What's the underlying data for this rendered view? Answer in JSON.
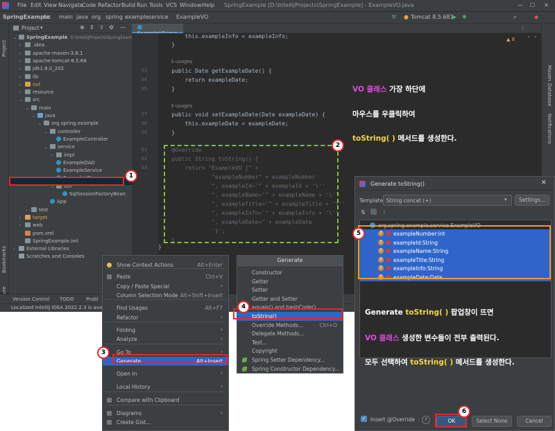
{
  "menubar": {
    "items": [
      "File",
      "Edit",
      "View",
      "Navigate",
      "Code",
      "Refactor",
      "Build",
      "Run",
      "Tools",
      "VCS",
      "Window",
      "Help"
    ],
    "title": "SpringExample [D:\\IntelliJProjects\\SpringExample] - ExampleVO.java"
  },
  "navbar": {
    "crumbs": [
      "SpringExample",
      "src",
      "main",
      "java",
      "org",
      "spring",
      "example",
      "service",
      "ExampleVO"
    ],
    "run_config": "Tomcat 8.5.681"
  },
  "project_panel": {
    "header": "Project",
    "tree": [
      {
        "label": "SpringExample",
        "extra": "D:\\IntelliJProjects\\SpringExamp",
        "icon": "folder-icon"
      },
      {
        "label": ".idea",
        "icon": "folder-icon"
      },
      {
        "label": "apache-maven-3.8.1",
        "icon": "folder-icon"
      },
      {
        "label": "apache-tomcat-8.5.68",
        "icon": "folder-icon"
      },
      {
        "label": "jdk1.8.0_202",
        "icon": "folder-icon"
      },
      {
        "label": "lib",
        "icon": "folder-icon"
      },
      {
        "label": "out",
        "icon": "folder-orange-icon"
      },
      {
        "label": "resource",
        "icon": "folder-icon"
      },
      {
        "label": "src",
        "icon": "folder-icon"
      },
      {
        "label": "main",
        "icon": "folder-icon"
      },
      {
        "label": "java",
        "icon": "folder-blue-icon"
      },
      {
        "label": "org.spring.example",
        "icon": "package-icon"
      },
      {
        "label": "controller",
        "icon": "package-icon"
      },
      {
        "label": "ExampleController",
        "icon": "class-icon"
      },
      {
        "label": "service",
        "icon": "package-icon"
      },
      {
        "label": "impl",
        "icon": "package-icon"
      },
      {
        "label": "ExampleDAO",
        "icon": "class-icon"
      },
      {
        "label": "ExampleService",
        "icon": "class-icon"
      },
      {
        "label": "ExampleVO",
        "icon": "class-icon"
      },
      {
        "label": "util",
        "icon": "package-icon"
      },
      {
        "label": "SqlSessionFactoryBean",
        "icon": "class-icon"
      },
      {
        "label": "App",
        "icon": "class-icon"
      },
      {
        "label": "test",
        "icon": "folder-icon"
      },
      {
        "label": "target",
        "icon": "folder-orange-icon"
      },
      {
        "label": "web",
        "icon": "folder-icon"
      },
      {
        "label": "pom.xml",
        "icon": "xml-icon"
      },
      {
        "label": "SpringExample.iml",
        "icon": "file-icon"
      },
      {
        "label": "External Libraries",
        "icon": "library-icon"
      },
      {
        "label": "Scratches and Consoles",
        "icon": "scratch-icon"
      }
    ]
  },
  "left_stripe": {
    "project": "Project",
    "bookmarks": "Bookmarks",
    "structure": "Structure"
  },
  "right_stripe": {
    "maven": "Maven",
    "database": "Database",
    "notifications": "Notifications"
  },
  "editor": {
    "tab": "ExampleVO.java",
    "warnings": "▲ 8",
    "line_numbers": [
      "",
      "",
      "",
      "",
      "53",
      "54",
      "55",
      "",
      "",
      "57",
      "58",
      "59",
      "",
      "61",
      "62",
      "63",
      "",
      "",
      "",
      "",
      "",
      "",
      "",
      "",
      ""
    ],
    "usages": "3 usages",
    "code_lines": [
      "        this.exampleInfo = exampleInfo;",
      "    }",
      "    public Date getExampleDate() {",
      "        return exampleDate;",
      "    }",
      "    public void setExampleDate(Date exampleDate) {",
      "        this.exampleDate = exampleDate;",
      "    }",
      "    @Override",
      "    public String toString() {",
      "        return \"ExampleVO {\" +",
      "                \"exampleNumber\" + exampleNumber",
      "                \", exampleId='\" + exampleId + '\\''",
      "                \", exampleName='\" + exampleName + '\\''",
      "                \", exampleTitle='\" + exampleTitle + '\\''",
      "                \", exampleInfo='\" + exampleInfo + '\\''",
      "                \", exampleDate=\" + exampleDate",
      "                '}';",
      "    }",
      "}"
    ]
  },
  "notes": {
    "top_1a": "VO 클래스",
    "top_1b": " 가장 하단에",
    "top_2": "마우스를 우클릭하여",
    "top_3a": "toString( )",
    "top_3b": " 메서드를 생성한다.",
    "bot_1a": "Generate ",
    "bot_1b": "toString( )",
    "bot_1c": " 팝업창이 뜨면",
    "bot_2a": "VO 클래스",
    "bot_2b": " 생성한 변수들이 전부 출력된다.",
    "bot_3a": "모두 선택하여 ",
    "bot_3b": "toString( )",
    "bot_3c": " 메서드를 생성한다."
  },
  "markers": [
    "1",
    "2",
    "3",
    "4",
    "5",
    "6"
  ],
  "context_menu": {
    "items": [
      {
        "label": "Show Context Actions",
        "key": "Alt+Enter"
      },
      {
        "label": "Paste",
        "key": "Ctrl+V"
      },
      {
        "label": "Copy / Paste Special",
        "key": ""
      },
      {
        "label": "Column Selection Mode",
        "key": "Alt+Shift+Insert"
      },
      {
        "label": "Find Usages",
        "key": "Alt+F7"
      },
      {
        "label": "Refactor",
        "key": ""
      },
      {
        "label": "Folding",
        "key": ""
      },
      {
        "label": "Analyze",
        "key": ""
      },
      {
        "label": "Go To",
        "key": ""
      },
      {
        "label": "Generate...",
        "key": "Alt+Insert"
      },
      {
        "label": "Open In",
        "key": ""
      },
      {
        "label": "Local History",
        "key": ""
      },
      {
        "label": "Compare with Clipboard",
        "key": ""
      },
      {
        "label": "Diagrams",
        "key": ""
      },
      {
        "label": "Create Gist...",
        "key": ""
      }
    ]
  },
  "generate_menu": {
    "title": "Generate",
    "items": [
      {
        "label": "Constructor",
        "key": ""
      },
      {
        "label": "Getter",
        "key": ""
      },
      {
        "label": "Setter",
        "key": ""
      },
      {
        "label": "Getter and Setter",
        "key": ""
      },
      {
        "label": "equals() and hashCode()",
        "key": ""
      },
      {
        "label": "toString()",
        "key": ""
      },
      {
        "label": "Override Methods...",
        "key": "Ctrl+O"
      },
      {
        "label": "Delegate Methods...",
        "key": ""
      },
      {
        "label": "Test...",
        "key": ""
      },
      {
        "label": "Copyright",
        "key": ""
      },
      {
        "label": "Spring Setter Dependency...",
        "key": ""
      },
      {
        "label": "Spring Constructor Dependency...",
        "key": ""
      }
    ]
  },
  "dialog": {
    "title": "Generate toString()",
    "template_label": "Template:",
    "template_value": "String concat (+)",
    "settings_button": "Settings...",
    "class_name": "org.spring.example.service.ExampleVO",
    "members": [
      "exampleNumber:int",
      "exampleId:String",
      "exampleName:String",
      "exampleTitle:String",
      "exampleInfo:String",
      "exampleDate:Date"
    ],
    "insert_override": "Insert @Override",
    "help": "?",
    "ok": "OK",
    "select_none": "Select None",
    "cancel": "Cancel"
  },
  "bottom_bar": {
    "version_control": "Version Control",
    "todo": "TODO",
    "problems": "Probl"
  },
  "status_bar": {
    "text": "Localized IntelliJ IDEA 2022.2.3 is available"
  },
  "colors": {
    "highlight_red": "#e8262a",
    "dashed_green": "#7fbf3f",
    "note_magenta": "#e24be2",
    "note_yellow": "#f5d93a",
    "selection_blue": "#2f65ca"
  }
}
